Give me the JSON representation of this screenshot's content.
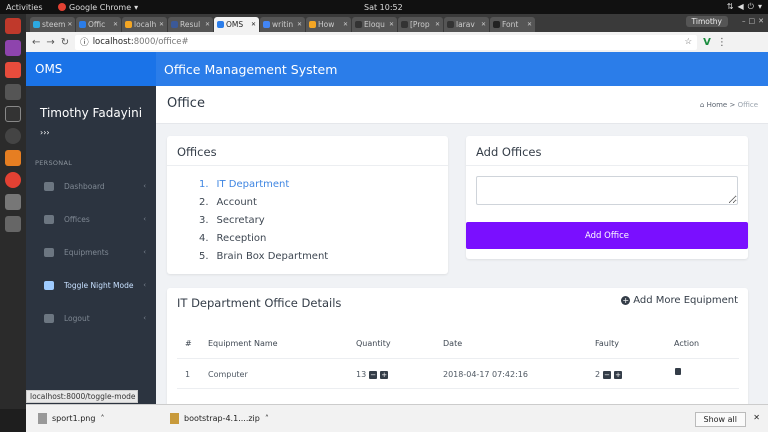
{
  "os": {
    "activities": "Activities",
    "app": "Google Chrome",
    "clock": "Sat 10:52"
  },
  "browser": {
    "tabs": [
      {
        "label": "steem",
        "color": "#2ca9e1"
      },
      {
        "label": "Offic",
        "color": "#2b7de9"
      },
      {
        "label": "localh",
        "color": "#f4a623"
      },
      {
        "label": "Resul",
        "color": "#3b5998"
      },
      {
        "label": "OMS",
        "color": "#2b7de9",
        "active": true
      },
      {
        "label": "writin",
        "color": "#4285f4"
      },
      {
        "label": "How",
        "color": "#f4a623"
      },
      {
        "label": "Eloqu",
        "color": "#333333"
      },
      {
        "label": "[Prop",
        "color": "#333333"
      },
      {
        "label": "larav",
        "color": "#333333"
      },
      {
        "label": "Font",
        "color": "#222222"
      }
    ],
    "profile": "Timothy",
    "url_host": "localhost:",
    "url_path": "8000/office#"
  },
  "app": {
    "brand": "OMS",
    "header_title": "Office Management System",
    "user_name": "Timothy Fadayini",
    "user_chevron": "›››",
    "section_label": "PERSONAL",
    "nav": [
      {
        "label": "Dashboard"
      },
      {
        "label": "Offices"
      },
      {
        "label": "Equipments"
      },
      {
        "label": "Toggle Night Mode",
        "highlight": true
      },
      {
        "label": "Logout"
      }
    ],
    "page_title": "Office",
    "breadcrumb_home": "Home",
    "breadcrumb_current": "Office"
  },
  "offices_card": {
    "title": "Offices",
    "items": [
      {
        "num": "1.",
        "label": "IT Department",
        "selected": true
      },
      {
        "num": "2.",
        "label": "Account"
      },
      {
        "num": "3.",
        "label": "Secretary"
      },
      {
        "num": "4.",
        "label": "Reception"
      },
      {
        "num": "5.",
        "label": "Brain Box Department"
      }
    ]
  },
  "add_card": {
    "title": "Add Offices",
    "textarea_value": "",
    "button": "Add Office"
  },
  "details": {
    "title": "IT Department Office Details",
    "add_more": "Add More Equipment",
    "headers": {
      "num": "#",
      "name": "Equipment Name",
      "qty": "Quantity",
      "date": "Date",
      "faulty": "Faulty",
      "action": "Action"
    },
    "rows": [
      {
        "num": "1",
        "name": "Computer",
        "qty": "13",
        "date": "2018-04-17 07:42:16",
        "faulty": "2"
      }
    ]
  },
  "status_url": "localhost:8000/toggle-mode",
  "downloads": {
    "items": [
      {
        "label": "sport1.png"
      },
      {
        "label": "bootstrap-4.1....zip"
      }
    ],
    "show_all": "Show all"
  }
}
